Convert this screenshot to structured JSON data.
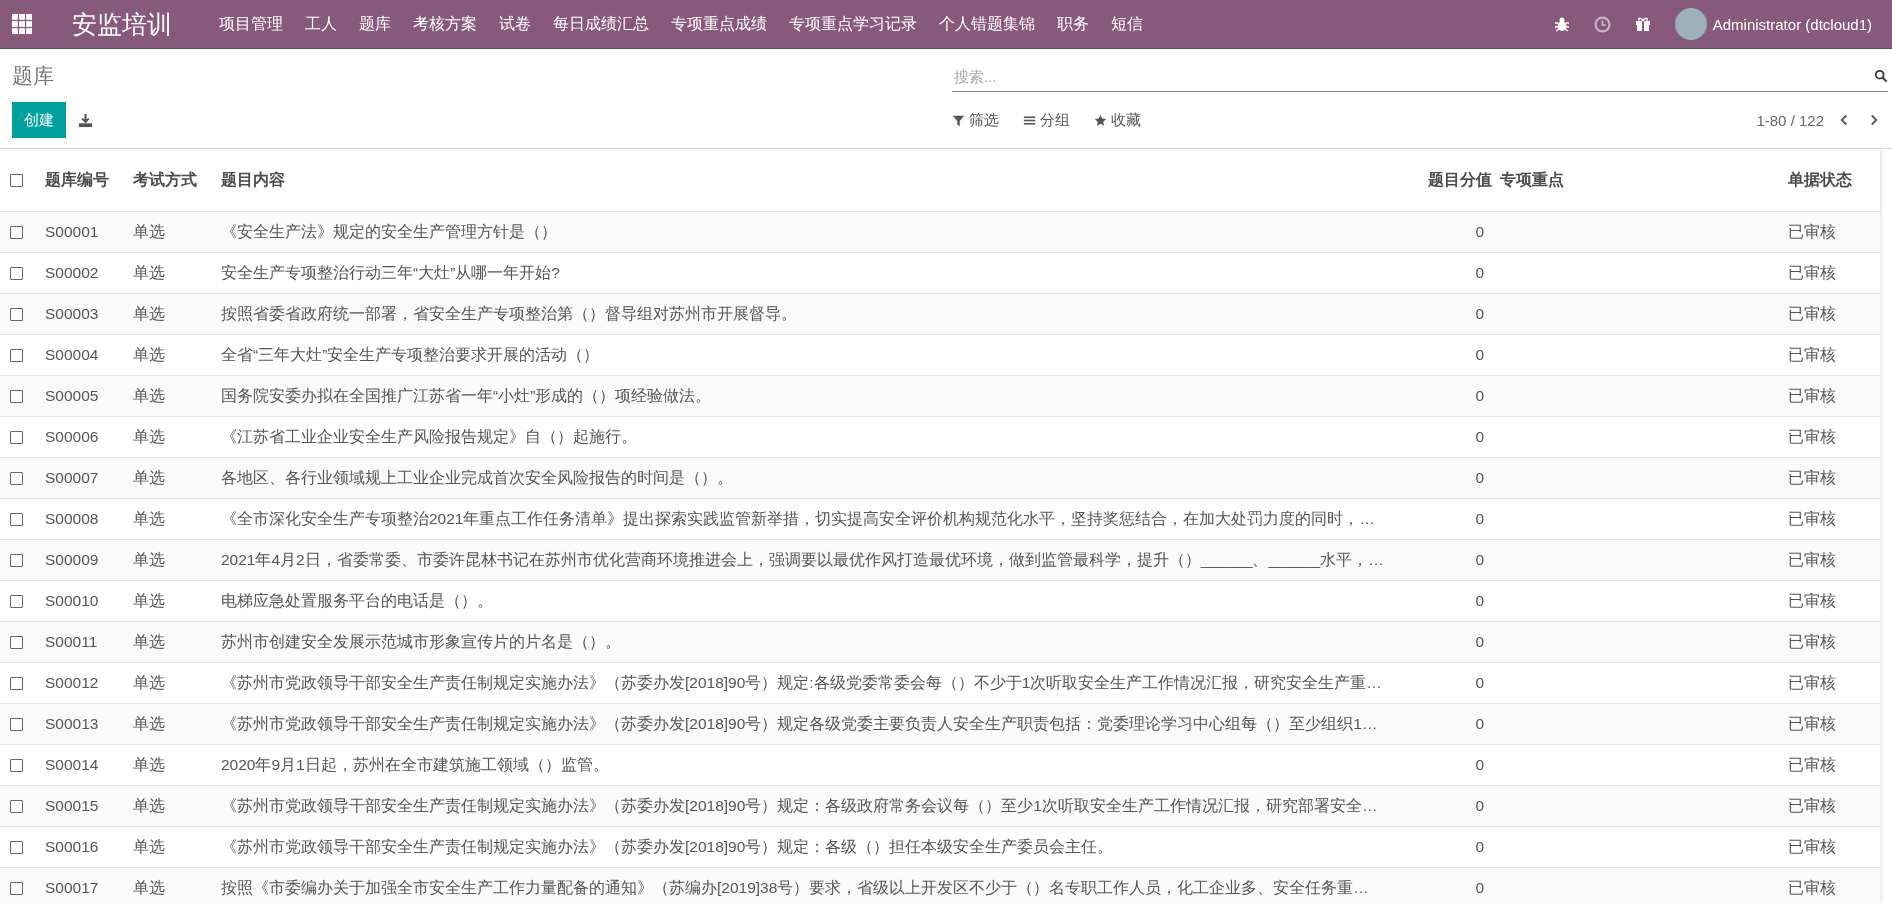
{
  "navbar": {
    "app_title": "安监培训",
    "menu": [
      "项目管理",
      "工人",
      "题库",
      "考核方案",
      "试卷",
      "每日成绩汇总",
      "专项重点成绩",
      "专项重点学习记录",
      "个人错题集锦",
      "职务",
      "短信"
    ],
    "user": "Administrator (dtcloud1)"
  },
  "control_panel": {
    "breadcrumb": "题库",
    "create_button": "创建",
    "search": {
      "placeholder": "搜索..."
    },
    "filters": [
      {
        "kind": "filter",
        "label": "筛选"
      },
      {
        "kind": "group",
        "label": "分组"
      },
      {
        "kind": "favorite",
        "label": "收藏"
      }
    ],
    "pager": "1-80 / 122"
  },
  "table": {
    "select_all": {
      "checked": false
    },
    "columns": [
      "题库编号",
      "考试方式",
      "题目内容",
      "题目分值",
      "专项重点",
      "单据状态"
    ],
    "rows": [
      {
        "checked": false,
        "cells": [
          "S00001",
          "单选",
          "《安全生产法》规定的安全生产管理方针是（）",
          "0",
          "",
          "已审核"
        ]
      },
      {
        "checked": false,
        "cells": [
          "S00002",
          "单选",
          "安全生产专项整治行动三年“大灶”从哪一年开始?",
          "0",
          "",
          "已审核"
        ]
      },
      {
        "checked": false,
        "cells": [
          "S00003",
          "单选",
          "按照省委省政府统一部署，省安全生产专项整治第（）督导组对苏州市开展督导。",
          "0",
          "",
          "已审核"
        ]
      },
      {
        "checked": false,
        "cells": [
          "S00004",
          "单选",
          "全省“三年大灶”安全生产专项整治要求开展的活动（）",
          "0",
          "",
          "已审核"
        ]
      },
      {
        "checked": false,
        "cells": [
          "S00005",
          "单选",
          "国务院安委办拟在全国推广江苏省一年“小灶”形成的（）项经验做法。",
          "0",
          "",
          "已审核"
        ]
      },
      {
        "checked": false,
        "cells": [
          "S00006",
          "单选",
          "《江苏省工业企业安全生产风险报告规定》自（）起施行。",
          "0",
          "",
          "已审核"
        ]
      },
      {
        "checked": false,
        "cells": [
          "S00007",
          "单选",
          "各地区、各行业领域规上工业企业完成首次安全风险报告的时间是（）。",
          "0",
          "",
          "已审核"
        ]
      },
      {
        "checked": false,
        "cells": [
          "S00008",
          "单选",
          "《全市深化安全生产专项整治2021年重点工作任务清单》提出探索实践监管新举措，切实提高安全评价机构规范化水平，坚持奖惩结合，在加大处罚力度的同时，…",
          "0",
          "",
          "已审核"
        ]
      },
      {
        "checked": false,
        "cells": [
          "S00009",
          "单选",
          "2021年4月2日，省委常委、市委许昆林书记在苏州市优化营商环境推进会上，强调要以最优作风打造最优环境，做到监管最科学，提升（）______、______水平，…",
          "0",
          "",
          "已审核"
        ]
      },
      {
        "checked": false,
        "cells": [
          "S00010",
          "单选",
          "电梯应急处置服务平台的电话是（）。",
          "0",
          "",
          "已审核"
        ]
      },
      {
        "checked": false,
        "cells": [
          "S00011",
          "单选",
          "苏州市创建安全发展示范城市形象宣传片的片名是（）。",
          "0",
          "",
          "已审核"
        ]
      },
      {
        "checked": false,
        "cells": [
          "S00012",
          "单选",
          "《苏州市党政领导干部安全生产责任制规定实施办法》（苏委办发[2018]90号）规定:各级党委常委会每（）不少于1次听取安全生产工作情况汇报，研究安全生产重…",
          "0",
          "",
          "已审核"
        ]
      },
      {
        "checked": false,
        "cells": [
          "S00013",
          "单选",
          "《苏州市党政领导干部安全生产责任制规定实施办法》（苏委办发[2018]90号）规定各级党委主要负责人安全生产职责包括：党委理论学习中心组每（）至少组织1…",
          "0",
          "",
          "已审核"
        ]
      },
      {
        "checked": false,
        "cells": [
          "S00014",
          "单选",
          "2020年9月1日起，苏州在全市建筑施工领域（）监管。",
          "0",
          "",
          "已审核"
        ]
      },
      {
        "checked": false,
        "cells": [
          "S00015",
          "单选",
          "《苏州市党政领导干部安全生产责任制规定实施办法》（苏委办发[2018]90号）规定：各级政府常务会议每（）至少1次听取安全生产工作情况汇报，研究部署安全…",
          "0",
          "",
          "已审核"
        ]
      },
      {
        "checked": false,
        "cells": [
          "S00016",
          "单选",
          "《苏州市党政领导干部安全生产责任制规定实施办法》（苏委办发[2018]90号）规定：各级（）担任本级安全生产委员会主任。",
          "0",
          "",
          "已审核"
        ]
      },
      {
        "checked": false,
        "cells": [
          "S00017",
          "单选",
          "按照《市委编办关于加强全市安全生产工作力量配备的通知》（苏编办[2019]38号）要求，省级以上开发区不少于（）名专职工作人员，化工企业多、安全任务重…",
          "0",
          "",
          "已审核"
        ]
      }
    ]
  }
}
